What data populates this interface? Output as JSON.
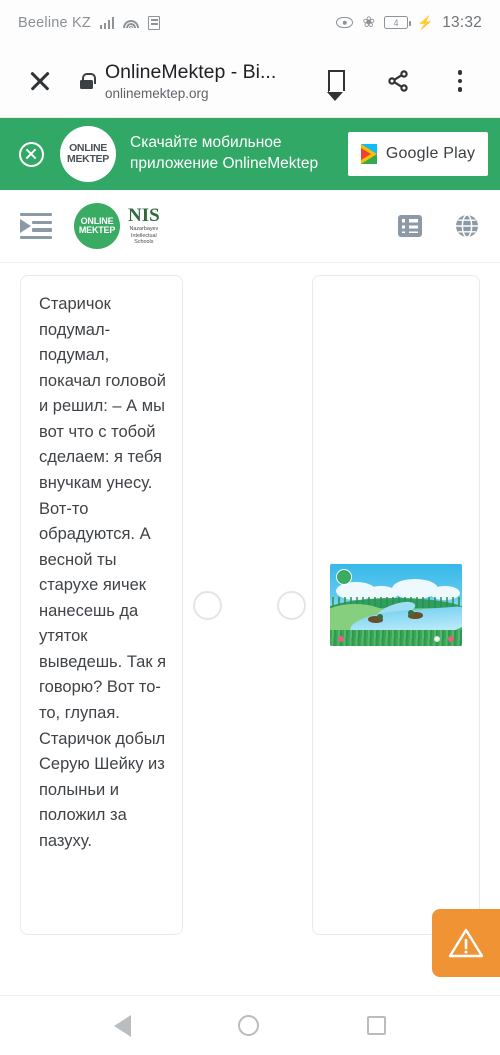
{
  "status_bar": {
    "carrier": "Beeline KZ",
    "battery_level": "4",
    "time": "13:32",
    "icons": [
      "signal-bars-icon",
      "wifi-icon",
      "sim-card-icon",
      "eye-icon",
      "bluetooth-icon",
      "battery-icon",
      "charging-bolt-icon"
    ]
  },
  "browser": {
    "close_label": "close-icon",
    "lock_label": "lock-icon",
    "page_title": "OnlineMektep - Bi...",
    "page_url": "onlinemektep.org",
    "bookmark_label": "bookmark-icon",
    "share_label": "share-icon",
    "menu_label": "more-options-icon"
  },
  "promo_banner": {
    "close_label": "close-icon",
    "logo_line1": "ONLINE",
    "logo_line2": "MEKTEP",
    "text_line1": "Скачайте мобильное",
    "text_line2": "приложение OnlineMektep",
    "store_button": "Google Play",
    "background_color": "#32a866"
  },
  "app_header": {
    "menu_icon": "indent-menu-icon",
    "om_logo_line1": "ONLINE",
    "om_logo_line2": "MEKTEP",
    "nis_logo_main": "NIS",
    "nis_logo_sub_line1": "Nazarbayev",
    "nis_logo_sub_line2": "Intellectual",
    "nis_logo_sub_line3": "Schools",
    "list_icon": "list-view-icon",
    "language_icon": "globe-icon",
    "accent_color": "#3aab62"
  },
  "task": {
    "text_card": "Старичок подумал-подумал, покачал головой и решил: – А мы вот что с тобой сделаем: я тебя внучкам унесу. Вот-то обрадуются. А весной ты старухе яичек нанесешь да утяток выведешь. Так я говорю? Вот то-то, глупая. Старичок добыл Серую Шейку из полыньи и положил за пазуху.",
    "connector_left": "match-connector-dot",
    "connector_right": "match-connector-dot",
    "image_alt": "Иллюстрация: река с утками на зелёном лугу"
  },
  "warning_button": {
    "label": "warning-icon",
    "color": "#ef9334"
  },
  "nav_bar": {
    "back": "back-button",
    "home": "home-button",
    "recents": "recent-apps-button"
  }
}
